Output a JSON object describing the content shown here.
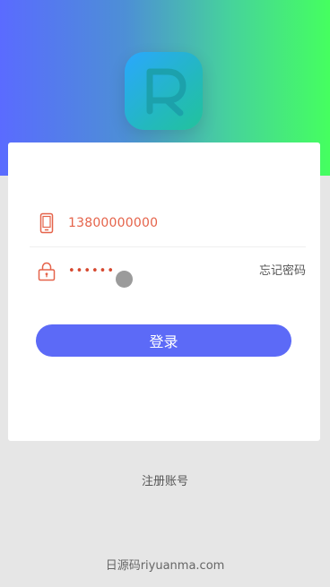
{
  "login_form": {
    "phone_value": "13800000000",
    "password_mask": "••••••",
    "forgot_label": "忘记密码",
    "login_label": "登录"
  },
  "register_label": "注册账号",
  "footer_text": "日源码riyuanma.com",
  "icons": {
    "logo": "R-logo-icon",
    "phone": "phone-icon",
    "lock": "lock-icon"
  },
  "colors": {
    "gradient_left": "#5a6bff",
    "gradient_right": "#45ff5f",
    "accent_button": "#5c6af7",
    "input_text": "#e5634a"
  }
}
